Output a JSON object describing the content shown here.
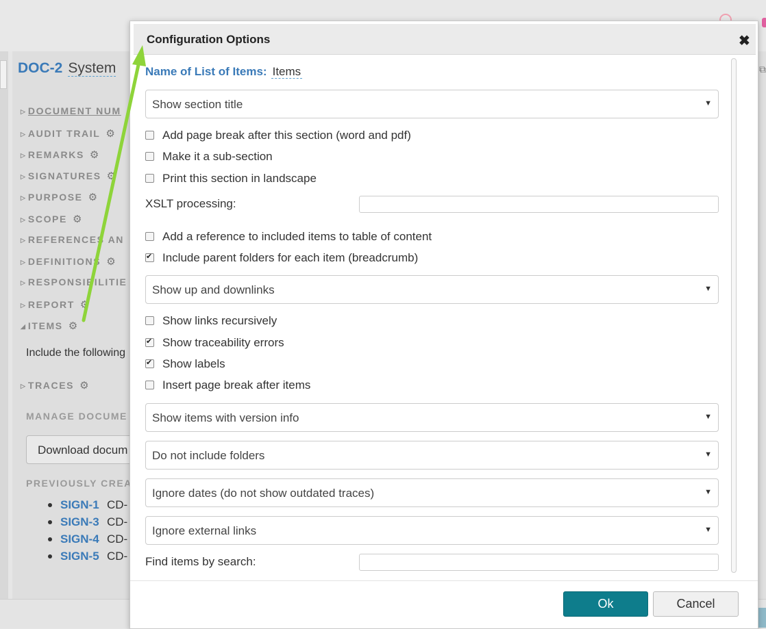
{
  "background": {
    "doc_id": "DOC-2",
    "doc_title": "System",
    "sections": [
      {
        "label": "DOCUMENT NUM",
        "gear": false
      },
      {
        "label": "AUDIT TRAIL",
        "gear": true
      },
      {
        "label": "REMARKS",
        "gear": true
      },
      {
        "label": "SIGNATURES",
        "gear": true
      },
      {
        "label": "PURPOSE",
        "gear": true
      },
      {
        "label": "SCOPE",
        "gear": true
      },
      {
        "label": "REFERENCES AN",
        "gear": false
      },
      {
        "label": "DEFINITIONS",
        "gear": true
      },
      {
        "label": "RESPONSIBILITIE",
        "gear": false
      },
      {
        "label": "REPORT",
        "gear": true
      },
      {
        "label": "ITEMS",
        "gear": true
      }
    ],
    "items_text": "Include the following",
    "traces": "TRACES",
    "manage_heading": "MANAGE DOCUME",
    "download_button": "Download docum",
    "previously_heading": "PREVIOUSLY CREA",
    "signed": [
      {
        "id": "SIGN-1",
        "cd": "CD-"
      },
      {
        "id": "SIGN-3",
        "cd": "CD-"
      },
      {
        "id": "SIGN-4",
        "cd": "CD-"
      },
      {
        "id": "SIGN-5",
        "cd": "CD-"
      }
    ]
  },
  "dialog": {
    "title": "Configuration Options",
    "close_symbol": "✖",
    "name_label": "Name of List of Items:",
    "name_value": "Items",
    "select_section_title": "Show section title",
    "chk_page_break": {
      "label": "Add page break after this section (word and pdf)",
      "checked": false
    },
    "chk_sub_section": {
      "label": "Make it a sub-section",
      "checked": false
    },
    "chk_landscape": {
      "label": "Print this section in landscape",
      "checked": false
    },
    "xslt_label": "XSLT processing:",
    "xslt_value": "",
    "chk_reference_toc": {
      "label": "Add a reference to included items to table of content",
      "checked": false
    },
    "chk_parent_folders": {
      "label": "Include parent folders for each item (breadcrumb)",
      "checked": true
    },
    "select_links": "Show up and downlinks",
    "chk_links_recursive": {
      "label": "Show links recursively",
      "checked": false
    },
    "chk_traceability_errors": {
      "label": "Show traceability errors",
      "checked": true
    },
    "chk_labels": {
      "label": "Show labels",
      "checked": true
    },
    "chk_insert_page_break": {
      "label": "Insert page break after items",
      "checked": false
    },
    "select_version": "Show items with version info",
    "select_folders": "Do not include folders",
    "select_dates": "Ignore dates (do not show outdated traces)",
    "select_external": "Ignore external links",
    "find_label": "Find items by search:",
    "find_value": "",
    "ok_button": "Ok",
    "cancel_button": "Cancel"
  },
  "colors": {
    "accent_blue": "#3a7ab8",
    "ok_button": "#0e7d8c",
    "annotation_arrow": "#8ed43a"
  }
}
